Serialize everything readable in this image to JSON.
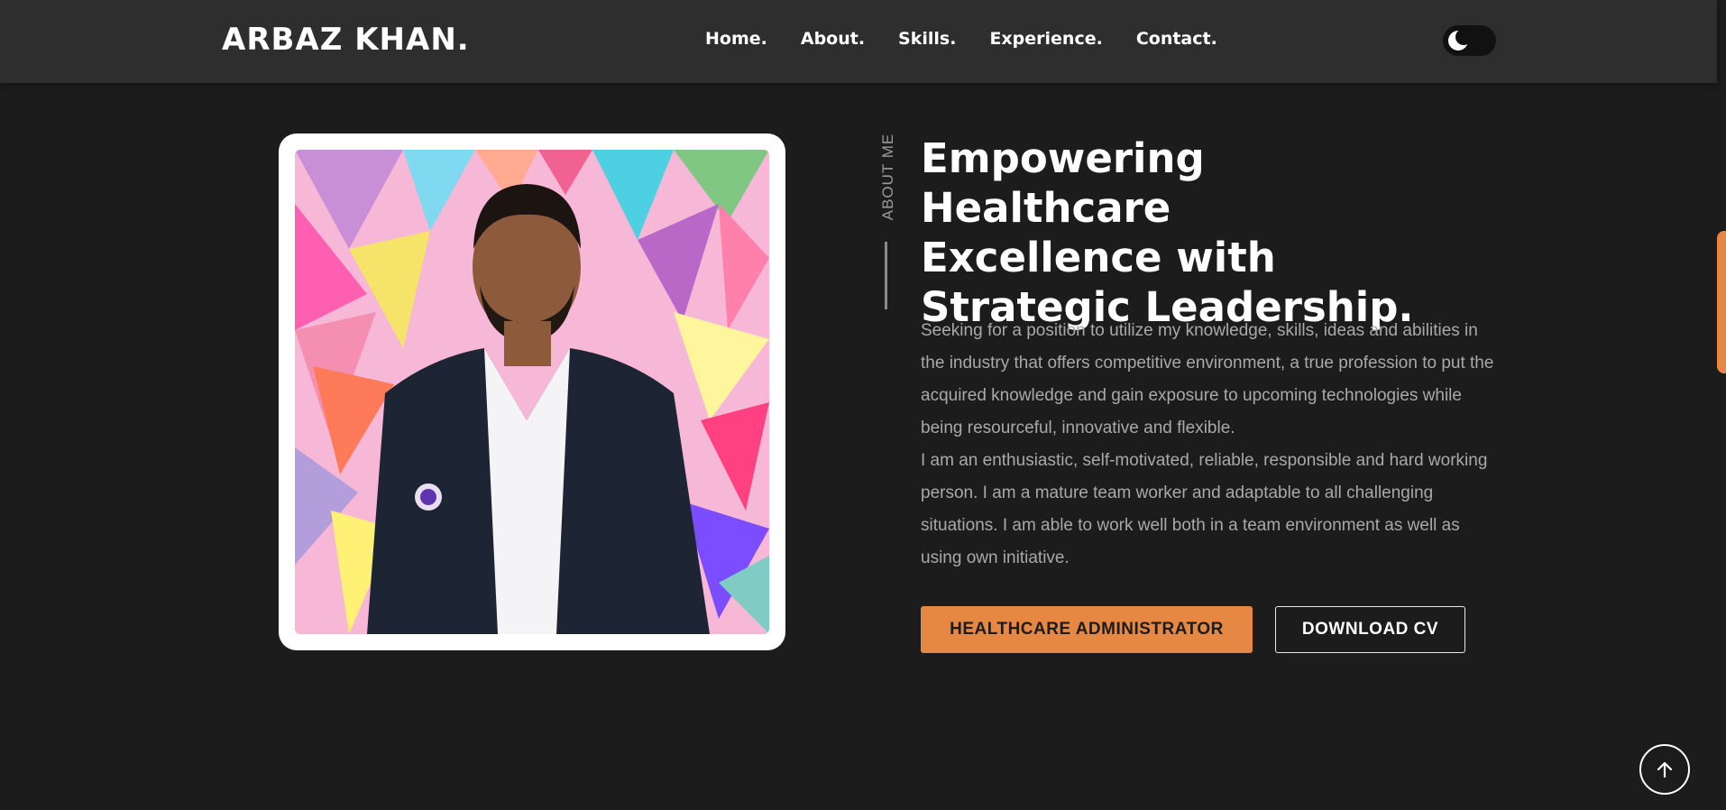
{
  "navbar": {
    "logo": "ARBAZ KHAN.",
    "links": [
      "Home.",
      "About.",
      "Skills.",
      "Experience.",
      "Contact."
    ],
    "theme_toggle_icon": "moon-icon"
  },
  "about": {
    "side_label": "ABOUT ME",
    "heading_lines": [
      "Empowering Healthcare",
      "Excellence with",
      "Strategic Leadership."
    ],
    "paragraph_1": "Seeking for a position to utilize my knowledge, skills, ideas and abilities in the industry that offers competitive environment, a true profession to put the acquired knowledge and gain exposure to upcoming technologies while being resourceful, innovative and flexible.",
    "paragraph_2": "I am an enthusiastic, self-motivated, reliable, responsible and hard working person. I am a mature team worker and adaptable to all challenging situations. I am able to work well both in a team environment as well as using own initiative.",
    "primary_button": "HEALTHCARE ADMINISTRATOR",
    "secondary_button": "DOWNLOAD CV"
  },
  "scroll_top_icon": "arrow-up-icon",
  "colors": {
    "accent": "#e68743",
    "background": "#1c1c1c",
    "navbar": "#2e2e2e",
    "muted_text": "#a9a9a9"
  }
}
